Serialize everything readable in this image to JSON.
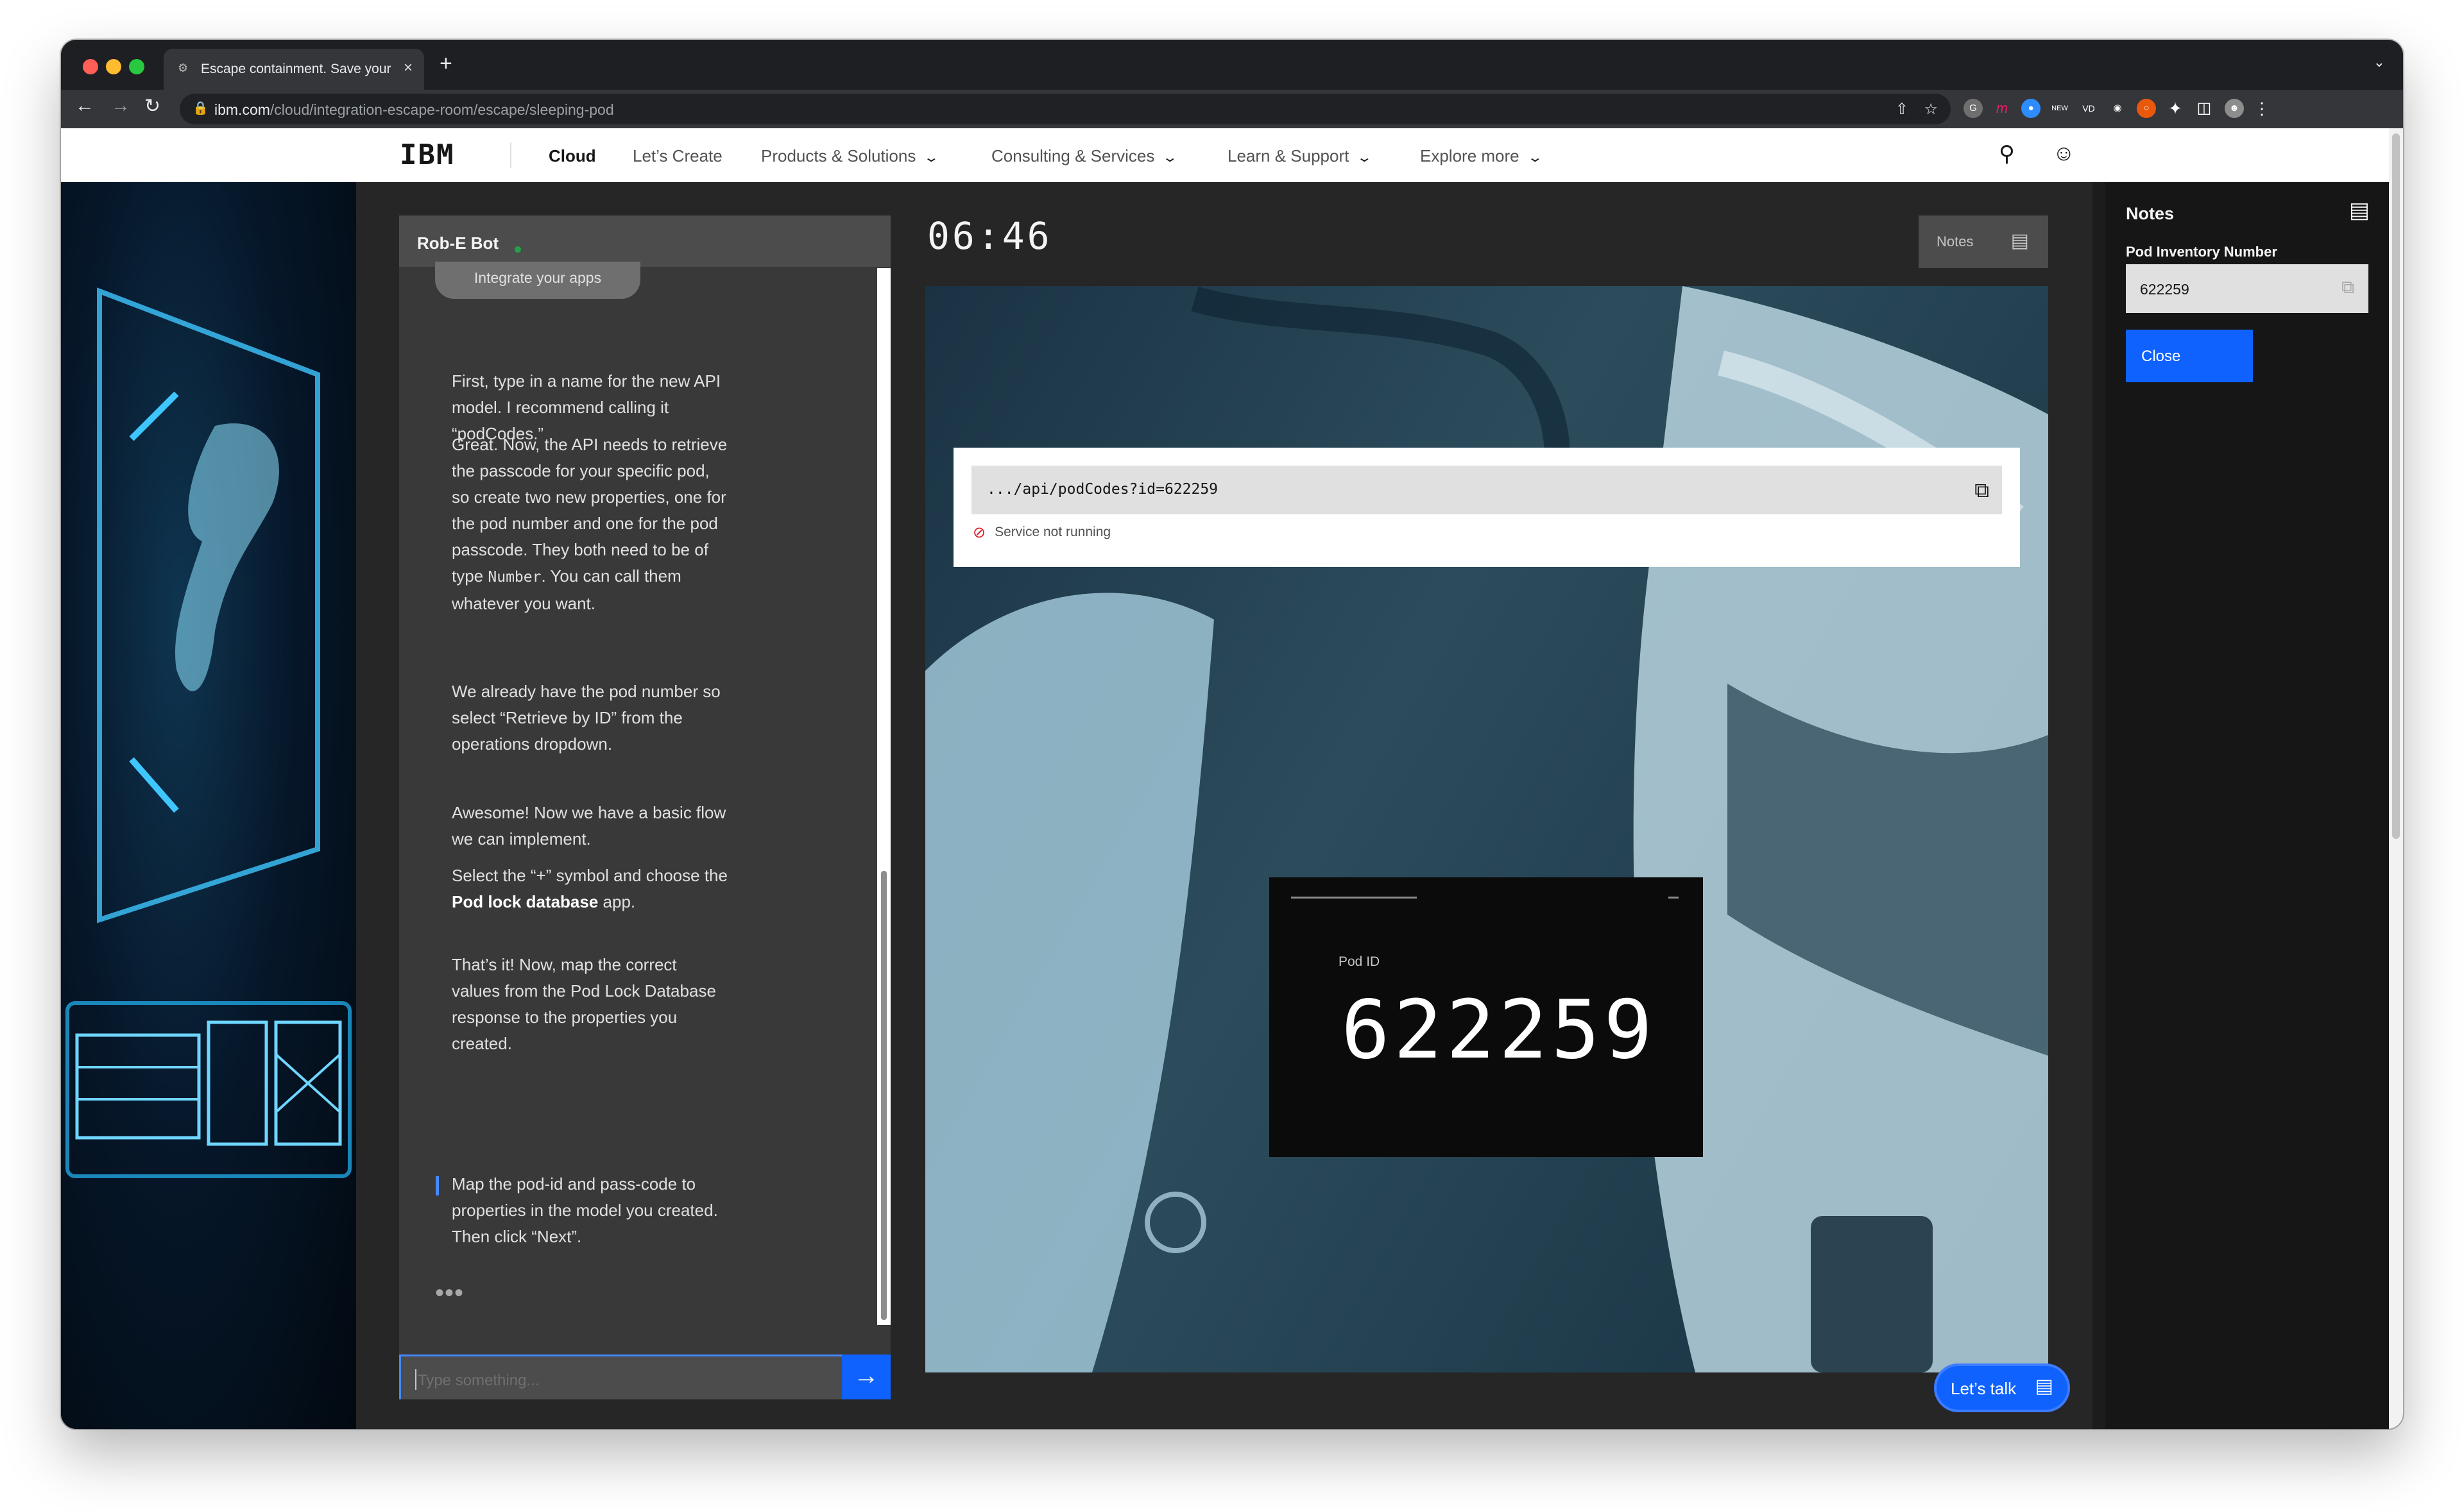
{
  "browser": {
    "tab_title": "Escape containment. Save your pod",
    "url_domain": "ibm.com",
    "url_path": "/cloud/integration-escape-room/escape/sleeping-pod"
  },
  "mast": {
    "logo": "IBM",
    "nav": [
      "Cloud",
      "Let’s Create",
      "Products & Solutions",
      "Consulting & Services",
      "Learn & Support",
      "Explore more"
    ]
  },
  "chat": {
    "bot_name": "Rob-E Bot",
    "chip": "Integrate your apps",
    "messages": [
      "First, type in a name for the new API model. I recommend calling it “podCodes.”",
      "Great. Now, the API needs to retrieve the passcode for your specific pod, so create two new properties, one for the pod number and one for the pod passcode. They both need to be of type",
      "Number",
      ". You can call them whatever you want.",
      "We already have the pod number so select “Retrieve by ID” from the operations dropdown.",
      "Awesome! Now we have a basic flow we can implement.",
      "Select the “+” symbol and choose the",
      "Pod lock database",
      "app.",
      "That’s it! Now, map the correct values from the Pod Lock Database response to the properties you created.",
      "Map the pod-id and pass-code to properties in the model you created. Then click “Next”."
    ],
    "typing": "•••",
    "input_placeholder": "Type something..."
  },
  "game": {
    "timer": "06:46",
    "notes_button": "Notes",
    "api_url": ".../api/podCodes?id=622259",
    "service_status": "Service not running",
    "pod_label": "Pod ID",
    "pod_id": "622259",
    "lets_talk": "Let’s talk"
  },
  "notes": {
    "title": "Notes",
    "field_label": "Pod Inventory Number",
    "field_value": "622259",
    "close": "Close"
  },
  "colors": {
    "accent": "#0f62fe",
    "status_online": "#24a148",
    "error": "#da1e28"
  }
}
